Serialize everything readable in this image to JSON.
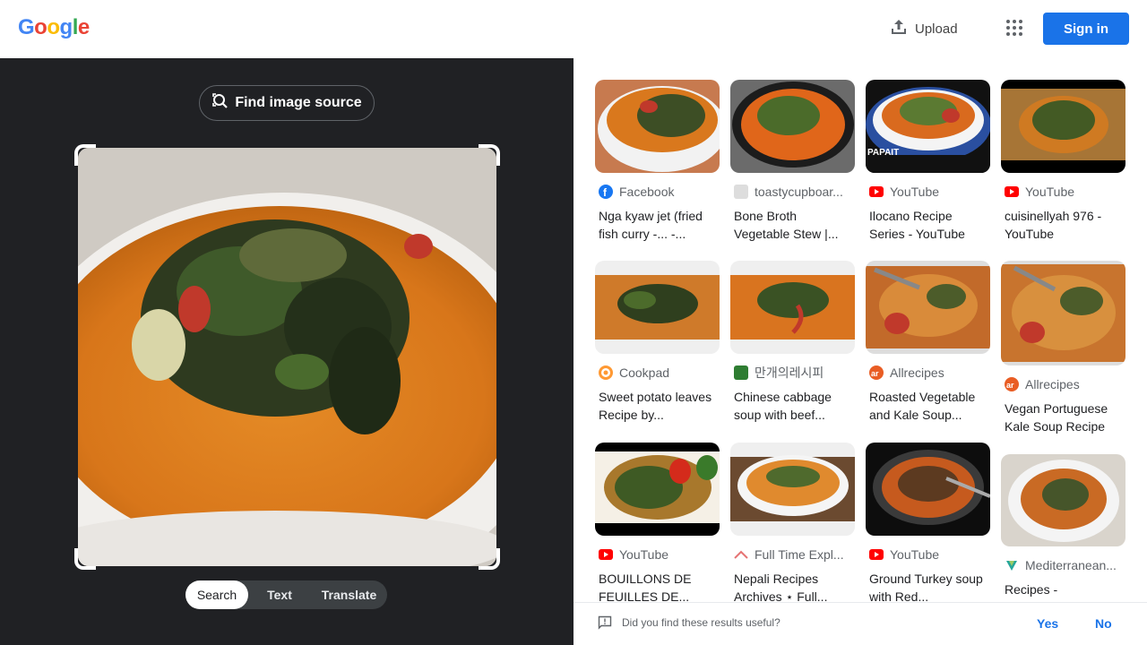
{
  "header": {
    "logo_letters": [
      {
        "ch": "G",
        "color": "#4285f4"
      },
      {
        "ch": "o",
        "color": "#ea4335"
      },
      {
        "ch": "o",
        "color": "#fbbc05"
      },
      {
        "ch": "g",
        "color": "#4285f4"
      },
      {
        "ch": "l",
        "color": "#34a853"
      },
      {
        "ch": "e",
        "color": "#ea4335"
      }
    ],
    "upload_label": "Upload",
    "apps_icon": "apps-grid-icon",
    "signin_label": "Sign in"
  },
  "left": {
    "find_source_label": "Find image source",
    "modes": [
      {
        "label": "Search",
        "active": true
      },
      {
        "label": "Text",
        "active": false
      },
      {
        "label": "Translate",
        "active": false
      }
    ]
  },
  "results": [
    {
      "source": "Facebook",
      "favicon": "facebook",
      "title": "Nga kyaw jet (fried fish curry -... -..."
    },
    {
      "source": "toastycupboar...",
      "favicon": "generic",
      "title": "Bone Broth Vegetable Stew |..."
    },
    {
      "source": "YouTube",
      "favicon": "youtube",
      "title": "Ilocano Recipe Series - YouTube",
      "overlay": "PAPAIT"
    },
    {
      "source": "YouTube",
      "favicon": "youtube",
      "title": "cuisinellyah 976 - YouTube"
    },
    {
      "source": "Cookpad",
      "favicon": "cookpad",
      "title": "Sweet potato leaves Recipe by..."
    },
    {
      "source": "만개의레시피",
      "favicon": "mangae",
      "title": "Chinese cabbage soup with beef..."
    },
    {
      "source": "Allrecipes",
      "favicon": "allrecipes",
      "title": "Roasted Vegetable and Kale Soup..."
    },
    {
      "source": "Allrecipes",
      "favicon": "allrecipes",
      "title": "Vegan Portuguese Kale Soup Recipe"
    },
    {
      "source": "YouTube",
      "favicon": "youtube",
      "title": "BOUILLONS DE FEUILLES DE..."
    },
    {
      "source": "Full Time Expl...",
      "favicon": "fulltime",
      "title": "Nepali Recipes Archives ⋆ Full..."
    },
    {
      "source": "YouTube",
      "favicon": "youtube",
      "title": "Ground Turkey soup with Red..."
    },
    {
      "source": "Mediterranean...",
      "favicon": "mediterranean",
      "title": "Recipes -"
    }
  ],
  "feedback": {
    "question": "Did you find these results useful?",
    "yes": "Yes",
    "no": "No"
  },
  "colors": {
    "accent": "#1a73e8",
    "dark_panel": "#202124"
  }
}
